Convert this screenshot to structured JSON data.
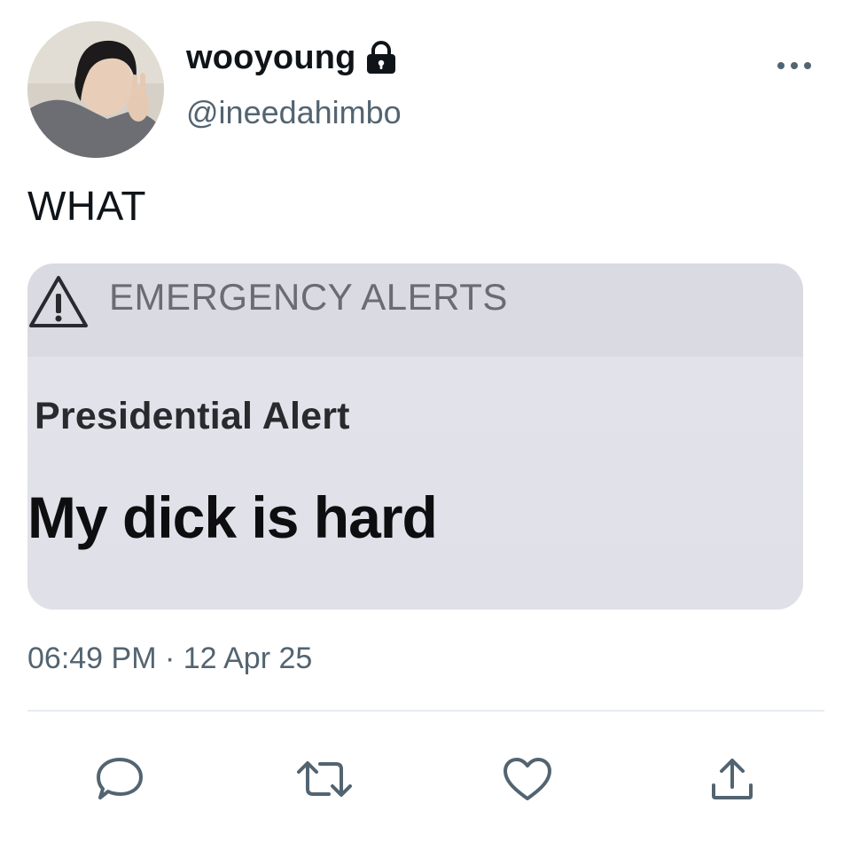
{
  "tweet": {
    "display_name": "wooyoung",
    "handle": "@ineedahimbo",
    "text": "WHAT",
    "timestamp": "06:49 PM · 12 Apr 25",
    "protected_icon": "lock-icon",
    "more_icon": "more-horizontal-icon"
  },
  "media": {
    "header": "EMERGENCY ALERTS",
    "subtitle": "Presidential Alert",
    "message": "My dick is hard",
    "header_icon": "warning-triangle-icon"
  },
  "actions": [
    {
      "name": "reply",
      "icon": "reply-icon"
    },
    {
      "name": "retweet",
      "icon": "retweet-icon"
    },
    {
      "name": "like",
      "icon": "heart-icon"
    },
    {
      "name": "share",
      "icon": "share-icon"
    }
  ],
  "colors": {
    "text_primary": "#0f1419",
    "text_secondary": "#536471",
    "icon_gray": "#536471",
    "divider": "#e6ecf0"
  }
}
